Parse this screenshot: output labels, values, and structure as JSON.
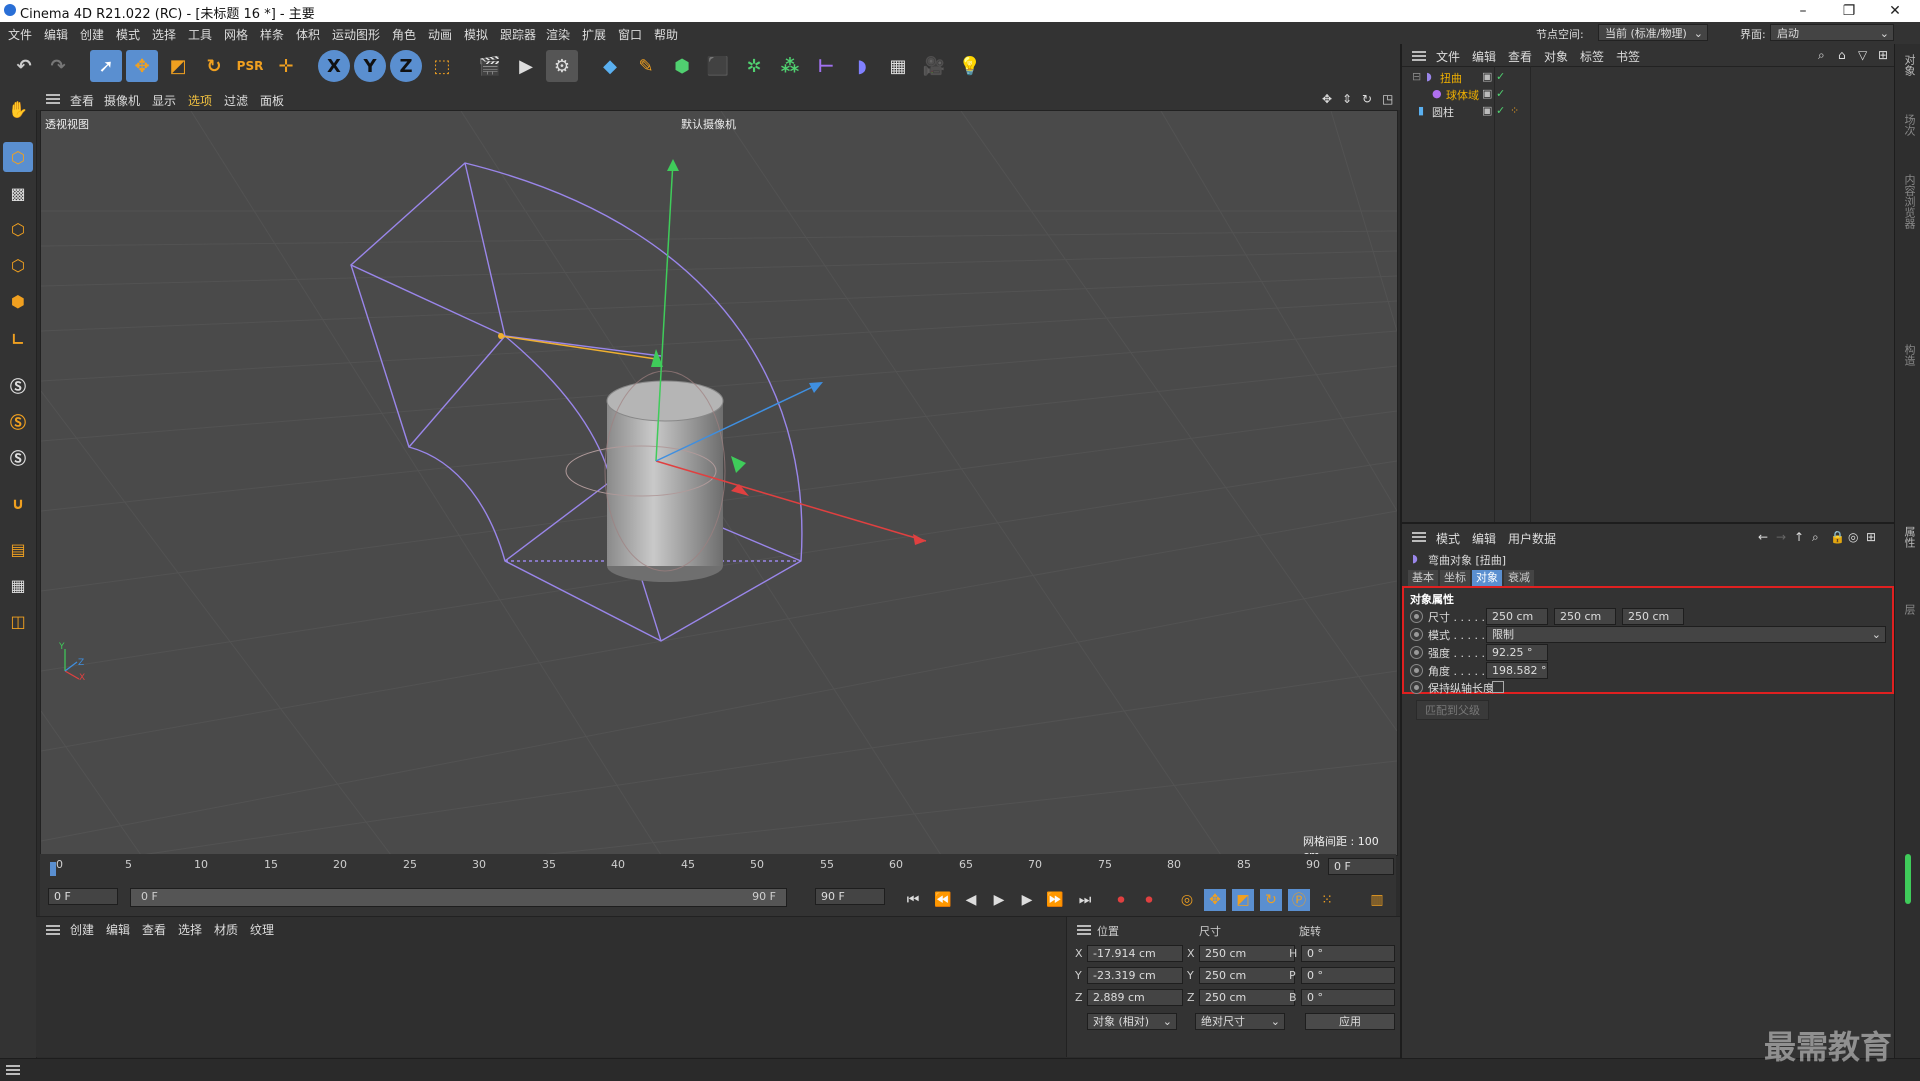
{
  "window": {
    "title": "Cinema 4D R21.022 (RC) - [未标题 16 *] - 主要"
  },
  "menu": [
    "文件",
    "编辑",
    "创建",
    "模式",
    "选择",
    "工具",
    "网格",
    "样条",
    "体积",
    "运动图形",
    "角色",
    "动画",
    "模拟",
    "跟踪器",
    "渲染",
    "扩展",
    "窗口",
    "帮助"
  ],
  "node_space": {
    "label": "节点空间:",
    "value": "当前 (标准/物理)"
  },
  "layout": {
    "label": "界面:",
    "value": "启动"
  },
  "toolbar": {
    "x": "X",
    "y": "Y",
    "z": "Z"
  },
  "viewport": {
    "menu": [
      "查看",
      "摄像机",
      "显示",
      "选项",
      "过滤",
      "面板"
    ],
    "name": "透视视图",
    "camera": "默认摄像机",
    "grid_spacing": "网格间距 : 100 cm",
    "axis_y": "Y",
    "axis_z": "Z",
    "axis_x": "X"
  },
  "timeline": {
    "ticks": [
      "0",
      "5",
      "10",
      "15",
      "20",
      "25",
      "30",
      "35",
      "40",
      "45",
      "50",
      "55",
      "60",
      "65",
      "70",
      "75",
      "80",
      "85",
      "90"
    ],
    "end_frame_display": "0 F",
    "start": "0 F",
    "range_start": "0 F",
    "range_end": "90 F",
    "end": "90 F"
  },
  "material_manager": {
    "menu": [
      "创建",
      "编辑",
      "查看",
      "选择",
      "材质",
      "纹理"
    ]
  },
  "coordinates": {
    "headers": {
      "position": "位置",
      "size": "尺寸",
      "rotation": "旋转"
    },
    "rows": [
      {
        "axis": "X",
        "pos": "-17.914 cm",
        "size_axis": "X",
        "size": "250 cm",
        "rot_axis": "H",
        "rot": "0 °"
      },
      {
        "axis": "Y",
        "pos": "-23.319 cm",
        "size_axis": "Y",
        "size": "250 cm",
        "rot_axis": "P",
        "rot": "0 °"
      },
      {
        "axis": "Z",
        "pos": "2.889 cm",
        "size_axis": "Z",
        "size": "250 cm",
        "rot_axis": "B",
        "rot": "0 °"
      }
    ],
    "mode": "对象 (相对)",
    "size_mode": "绝对尺寸",
    "apply": "应用"
  },
  "object_manager": {
    "menu": [
      "文件",
      "编辑",
      "查看",
      "对象",
      "标签",
      "书签"
    ],
    "objects": [
      {
        "name": "扭曲",
        "color": "#f0b000"
      },
      {
        "name": "球体域",
        "color": "#f0b000"
      },
      {
        "name": "圆柱",
        "color": "#cfcfcf"
      }
    ]
  },
  "attribute_manager": {
    "menu": [
      "模式",
      "编辑",
      "用户数据"
    ],
    "object_title": "弯曲对象 [扭曲]",
    "tabs": [
      "基本",
      "坐标",
      "对象",
      "衰减"
    ],
    "active_tab": "对象",
    "section": "对象属性",
    "size": {
      "label": "尺寸 . . . . . .",
      "x": "250 cm",
      "y": "250 cm",
      "z": "250 cm"
    },
    "mode": {
      "label": "模式 . . . . . .",
      "value": "限制"
    },
    "strength": {
      "label": "强度 . . . . . .",
      "value": "92.25 °"
    },
    "angle": {
      "label": "角度 . . . . . .",
      "value": "198.582 °"
    },
    "keep_length": {
      "label": "保持纵轴长度"
    },
    "fit_button": "匹配到父级",
    "highlight_color": "#e02020"
  },
  "right_strip": [
    "对象",
    "场次",
    "内容浏览器",
    "构造",
    "属性",
    "层"
  ],
  "watermark": "最需教育"
}
